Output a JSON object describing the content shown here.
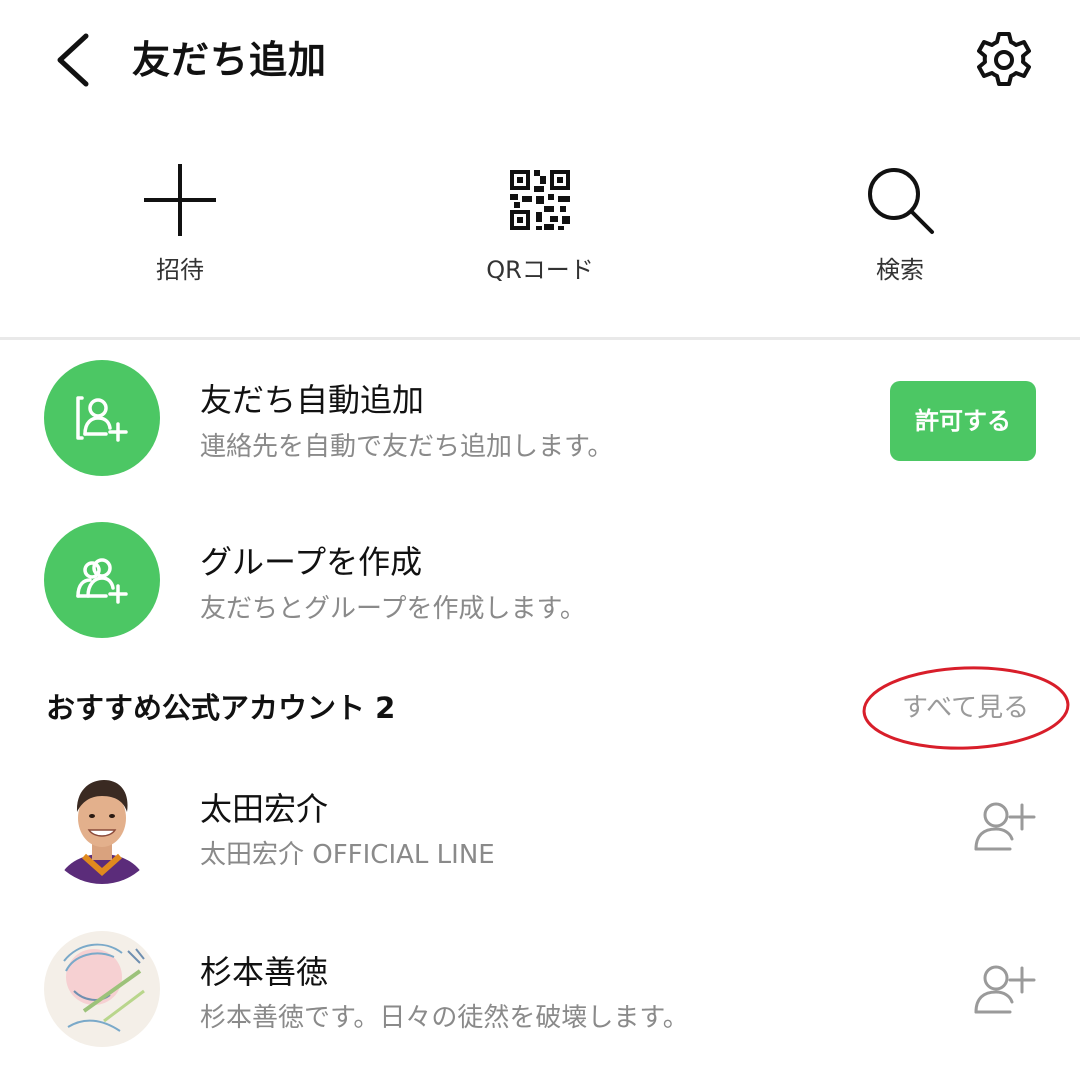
{
  "header": {
    "title": "友だち追加"
  },
  "actions": [
    {
      "label": "招待",
      "icon": "plus-icon"
    },
    {
      "label": "QRコード",
      "icon": "qr-code-icon"
    },
    {
      "label": "検索",
      "icon": "search-icon"
    }
  ],
  "auto_add": {
    "title": "友だち自動追加",
    "subtitle": "連絡先を自動で友だち追加します。",
    "button_label": "許可する",
    "icon": "contact-add-icon"
  },
  "create_group": {
    "title": "グループを作成",
    "subtitle": "友だちとグループを作成します。",
    "icon": "group-add-icon"
  },
  "recommended": {
    "title": "おすすめ公式アカウント 2",
    "see_all_label": "すべて見る",
    "accounts": [
      {
        "name": "太田宏介",
        "subtitle": "太田宏介 OFFICIAL LINE"
      },
      {
        "name": "杉本善徳",
        "subtitle": "杉本善徳です。日々の徒然を破壊します。"
      }
    ]
  },
  "colors": {
    "accent_green": "#4cc764",
    "annotation_red": "#d81e2a",
    "muted_text": "#8a8a8a",
    "divider": "#e9e9e9"
  }
}
